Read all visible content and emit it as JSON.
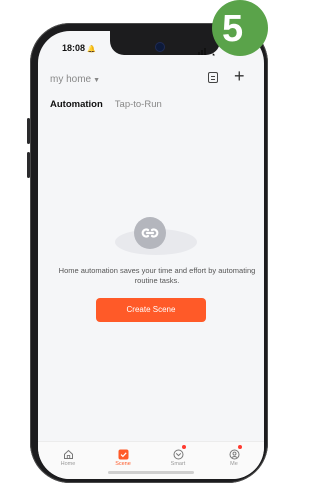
{
  "status_bar": {
    "time": "18:08",
    "bell": "🔔"
  },
  "step_badge": "5",
  "header": {
    "home_selector": "my home",
    "caret": "▼",
    "add_glyph": "+"
  },
  "tabs": [
    {
      "label": "Automation",
      "active": true
    },
    {
      "label": "Tap-to-Run",
      "active": false
    }
  ],
  "empty_state": {
    "message": "Home automation saves your time and effort by automating routine tasks.",
    "button_label": "Create Scene"
  },
  "bottom_nav": [
    {
      "label": "Home",
      "icon": "house-icon",
      "active": false
    },
    {
      "label": "Scene",
      "icon": "scene-check-icon",
      "active": true
    },
    {
      "label": "Smart",
      "icon": "smart-icon",
      "active": false
    },
    {
      "label": "Me",
      "icon": "profile-icon",
      "active": false
    }
  ],
  "colors": {
    "accent": "#ff5a28",
    "badge": "#5aa34a",
    "background": "#f5f6f8"
  }
}
